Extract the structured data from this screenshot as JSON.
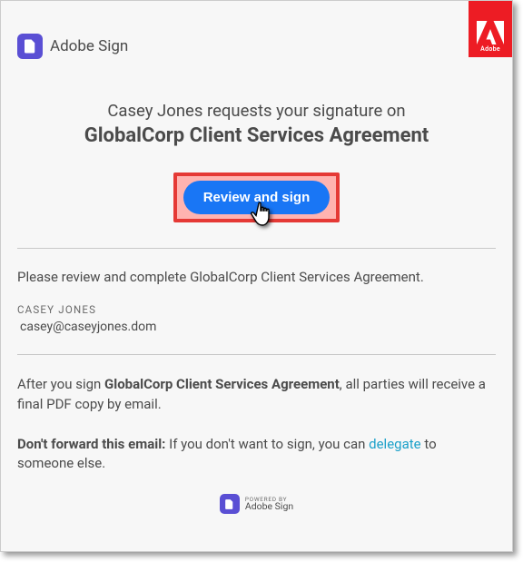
{
  "brand": {
    "name": "Adobe Sign",
    "corp": "Adobe"
  },
  "title": {
    "line1": "Casey Jones requests your signature on",
    "line2": "GlobalCorp Client Services Agreement"
  },
  "cta": {
    "label": "Review and sign"
  },
  "instruction": "Please review and complete GlobalCorp Client Services Agreement.",
  "sender": {
    "name": "CASEY JONES",
    "email": "casey@caseyjones.dom"
  },
  "footer": {
    "after_sign_prefix": "After you sign ",
    "after_sign_doc": "GlobalCorp Client Services Agreement",
    "after_sign_suffix": ", all parties will receive a final PDF copy by email.",
    "forward_bold": "Don't forward this email:",
    "forward_text1": " If you don't want to sign, you can ",
    "delegate": "delegate",
    "forward_text2": " to someone else."
  },
  "powered": {
    "label": "POWERED BY",
    "brand": "Adobe Sign"
  }
}
